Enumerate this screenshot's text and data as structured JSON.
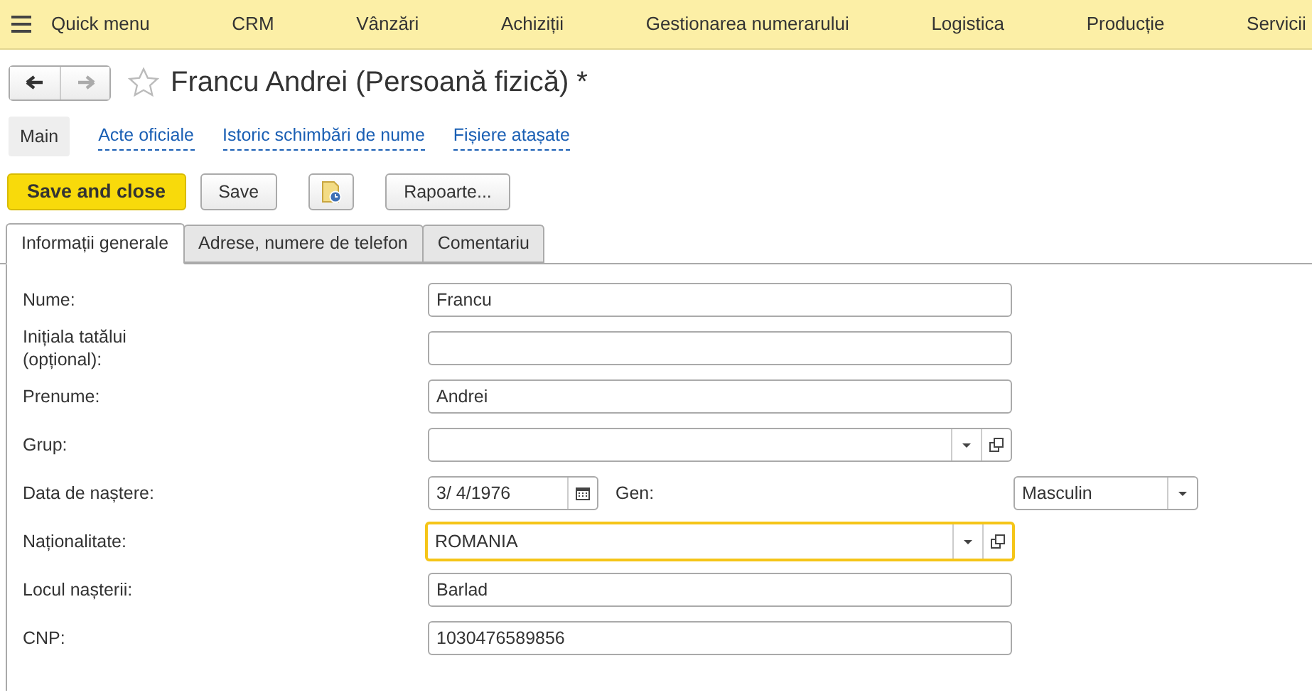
{
  "menu": {
    "items": [
      {
        "label": "Quick menu"
      },
      {
        "label": "CRM"
      },
      {
        "label": "Vânzări"
      },
      {
        "label": "Achiziții"
      },
      {
        "label": "Gestionarea numerarului"
      },
      {
        "label": "Logistica"
      },
      {
        "label": "Producție"
      },
      {
        "label": "Servicii"
      }
    ]
  },
  "nav": {
    "back_disabled": false,
    "forward_disabled": true
  },
  "title": "Francu Andrei (Persoană fizică) *",
  "favorite": false,
  "links": [
    {
      "label": "Main",
      "selected": true
    },
    {
      "label": "Acte oficiale",
      "selected": false
    },
    {
      "label": "Istoric schimbări de nume",
      "selected": false
    },
    {
      "label": "Fișiere atașate",
      "selected": false
    }
  ],
  "toolbar": [
    {
      "kind": "primary",
      "label": "Save and close"
    },
    {
      "kind": "button",
      "label": "Save"
    },
    {
      "kind": "icon"
    },
    {
      "kind": "button",
      "label": "Rapoarte..."
    }
  ],
  "tabs": [
    {
      "label": "Informații generale",
      "selected": true
    },
    {
      "label": "Adrese, numere de telefon",
      "selected": false
    },
    {
      "label": "Comentariu",
      "selected": false
    }
  ],
  "fields": [
    {
      "label": "Nume:",
      "kind": "text",
      "value": "Francu",
      "focused": false
    },
    {
      "label": "Inițiala tatălui (opțional):",
      "kind": "text",
      "focused": false
    },
    {
      "label": "Prenume:",
      "kind": "text",
      "value": "Andrei",
      "focused": false
    },
    {
      "label": "Grup:",
      "kind": "lookup",
      "focused": false
    },
    {
      "label": "Data de naștere:",
      "kind": "date",
      "value": "3/ 4/1976",
      "focused": false,
      "extra": {
        "label": "Gen:",
        "value": "Masculin"
      }
    },
    {
      "label": "Naționalitate:",
      "kind": "lookup",
      "value": "ROMANIA",
      "focused": true
    },
    {
      "label": "Locul nașterii:",
      "kind": "text",
      "value": "Barlad",
      "focused": false
    },
    {
      "label": "CNP:",
      "kind": "text",
      "value": "1030476589856",
      "focused": false
    }
  ]
}
